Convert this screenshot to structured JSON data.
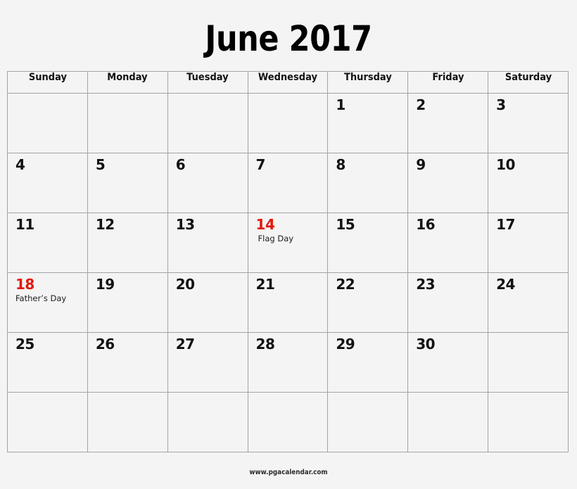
{
  "title": "June 2017",
  "month": "June",
  "year": "2017",
  "footer": "www.pgacalendar.com",
  "colors": {
    "background": "#f4f4f4",
    "border": "#a3a3a3",
    "text": "#111111",
    "holiday": "#e2180f"
  },
  "weekdays": [
    {
      "label": "Sunday"
    },
    {
      "label": "Monday"
    },
    {
      "label": "Tuesday"
    },
    {
      "label": "Wednesday"
    },
    {
      "label": "Thursday"
    },
    {
      "label": "Friday"
    },
    {
      "label": "Saturday"
    }
  ],
  "weeks": [
    [
      {
        "day": "",
        "event": "",
        "holiday": false
      },
      {
        "day": "",
        "event": "",
        "holiday": false
      },
      {
        "day": "",
        "event": "",
        "holiday": false
      },
      {
        "day": "",
        "event": "",
        "holiday": false
      },
      {
        "day": "1",
        "event": "",
        "holiday": false
      },
      {
        "day": "2",
        "event": "",
        "holiday": false
      },
      {
        "day": "3",
        "event": "",
        "holiday": false
      }
    ],
    [
      {
        "day": "4",
        "event": "",
        "holiday": false
      },
      {
        "day": "5",
        "event": "",
        "holiday": false
      },
      {
        "day": "6",
        "event": "",
        "holiday": false
      },
      {
        "day": "7",
        "event": "",
        "holiday": false
      },
      {
        "day": "8",
        "event": "",
        "holiday": false
      },
      {
        "day": "9",
        "event": "",
        "holiday": false
      },
      {
        "day": "10",
        "event": "",
        "holiday": false
      }
    ],
    [
      {
        "day": "11",
        "event": "",
        "holiday": false
      },
      {
        "day": "12",
        "event": "",
        "holiday": false
      },
      {
        "day": "13",
        "event": "",
        "holiday": false
      },
      {
        "day": "14",
        "event": "Flag Day",
        "holiday": true
      },
      {
        "day": "15",
        "event": "",
        "holiday": false
      },
      {
        "day": "16",
        "event": "",
        "holiday": false
      },
      {
        "day": "17",
        "event": "",
        "holiday": false
      }
    ],
    [
      {
        "day": "18",
        "event": "Father’s Day",
        "holiday": true
      },
      {
        "day": "19",
        "event": "",
        "holiday": false
      },
      {
        "day": "20",
        "event": "",
        "holiday": false
      },
      {
        "day": "21",
        "event": "",
        "holiday": false
      },
      {
        "day": "22",
        "event": "",
        "holiday": false
      },
      {
        "day": "23",
        "event": "",
        "holiday": false
      },
      {
        "day": "24",
        "event": "",
        "holiday": false
      }
    ],
    [
      {
        "day": "25",
        "event": "",
        "holiday": false
      },
      {
        "day": "26",
        "event": "",
        "holiday": false
      },
      {
        "day": "27",
        "event": "",
        "holiday": false
      },
      {
        "day": "28",
        "event": "",
        "holiday": false
      },
      {
        "day": "29",
        "event": "",
        "holiday": false
      },
      {
        "day": "30",
        "event": "",
        "holiday": false
      },
      {
        "day": "",
        "event": "",
        "holiday": false
      }
    ],
    [
      {
        "day": "",
        "event": "",
        "holiday": false
      },
      {
        "day": "",
        "event": "",
        "holiday": false
      },
      {
        "day": "",
        "event": "",
        "holiday": false
      },
      {
        "day": "",
        "event": "",
        "holiday": false
      },
      {
        "day": "",
        "event": "",
        "holiday": false
      },
      {
        "day": "",
        "event": "",
        "holiday": false
      },
      {
        "day": "",
        "event": "",
        "holiday": false
      }
    ]
  ]
}
